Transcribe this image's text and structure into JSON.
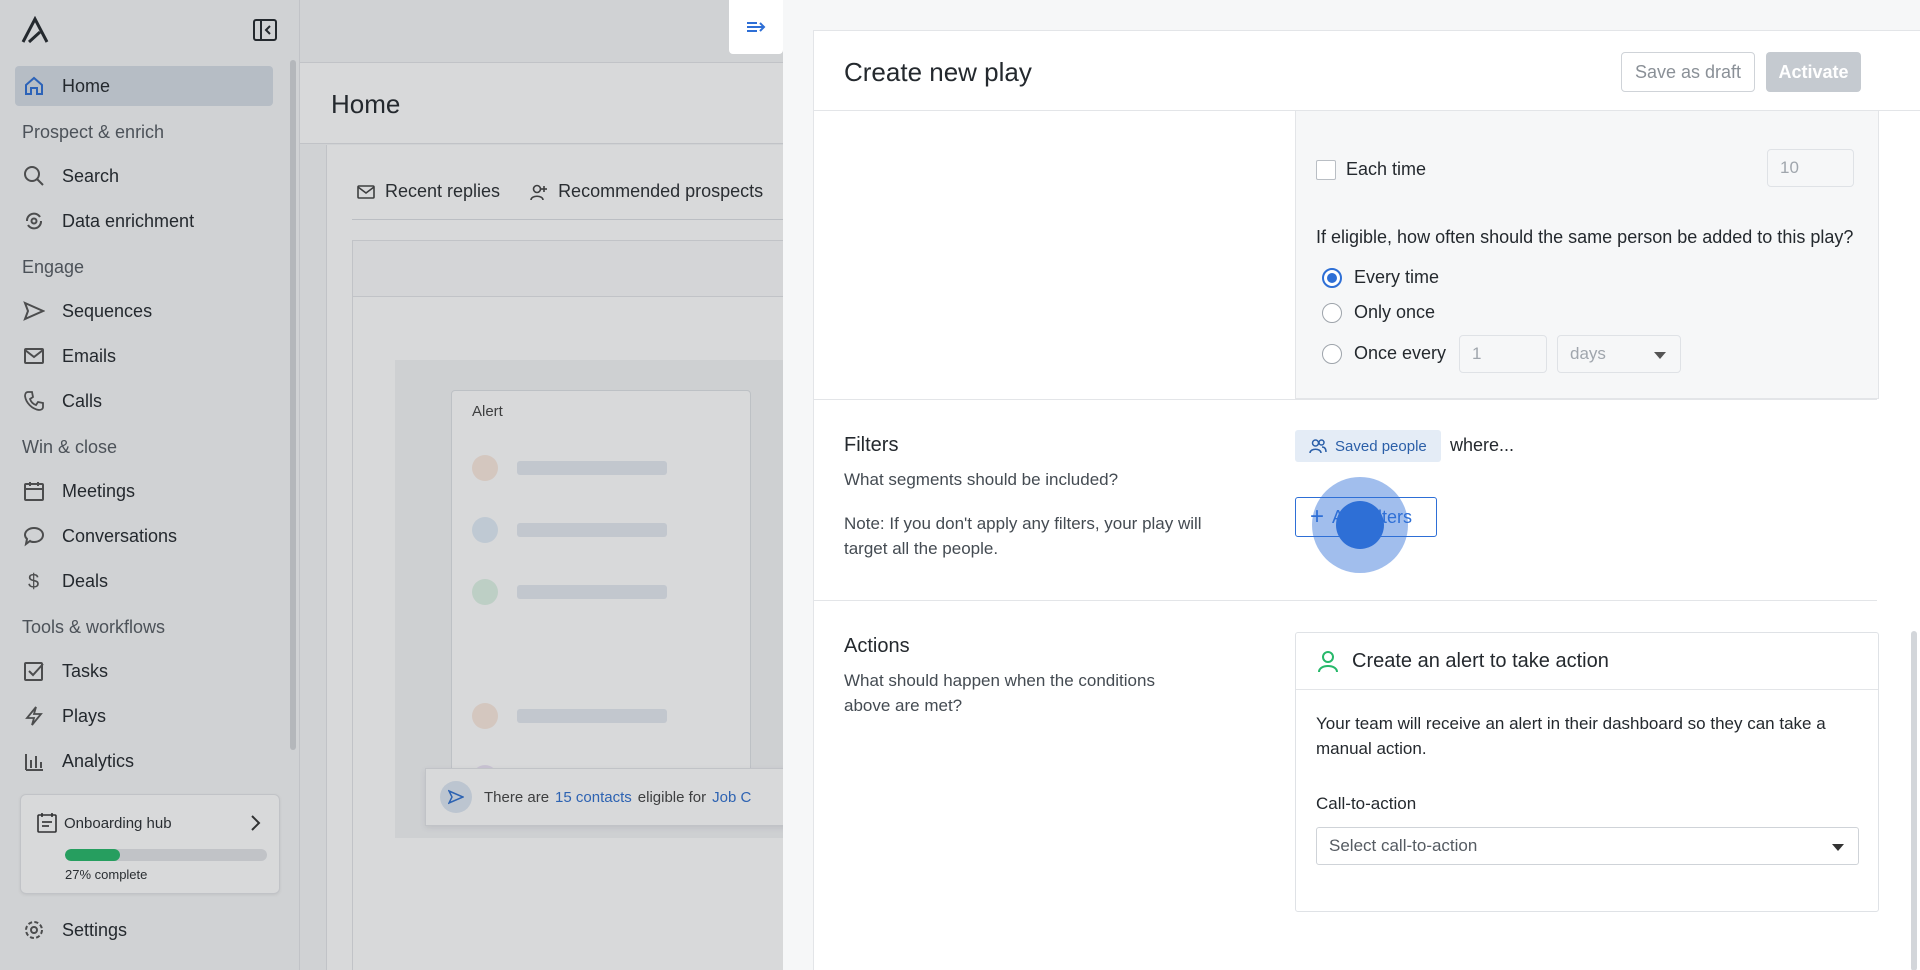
{
  "sidebar": {
    "nav_home": "Home",
    "section_prospect": "Prospect & enrich",
    "nav_search": "Search",
    "nav_data_enrichment": "Data enrichment",
    "section_engage": "Engage",
    "nav_sequences": "Sequences",
    "nav_emails": "Emails",
    "nav_calls": "Calls",
    "section_win": "Win & close",
    "nav_meetings": "Meetings",
    "nav_conversations": "Conversations",
    "nav_deals": "Deals",
    "section_tools": "Tools & workflows",
    "nav_tasks": "Tasks",
    "nav_plays": "Plays",
    "nav_analytics": "Analytics",
    "nav_settings": "Settings"
  },
  "onboarding": {
    "title": "Onboarding hub",
    "progress_text": "27% complete",
    "progress_fraction": 0.27
  },
  "main": {
    "title": "Home",
    "tab_recent_replies": "Recent replies",
    "tab_recommended": "Recommended prospects",
    "alert_title": "Alert",
    "eligible_prefix": "There are",
    "eligible_link": "15 contacts",
    "eligible_mid": "eligible for",
    "eligible_play": "Job C"
  },
  "drawer": {
    "title": "Create new play",
    "save_draft": "Save as draft",
    "activate": "Activate",
    "frequency": {
      "each_time_label": "Each time",
      "each_time_placeholder": "10",
      "question": "If eligible, how often should the same person be added to this play?",
      "opt_every_time": "Every time",
      "opt_only_once": "Only once",
      "opt_once_every": "Once every",
      "once_every_value": "1",
      "once_every_unit": "days"
    },
    "filters": {
      "title": "Filters",
      "desc": "What segments should be included?",
      "note": "Note: If you don't apply any filters, your play will target all the people.",
      "chip": "Saved people",
      "where": "where...",
      "add_button": "Add filters"
    },
    "actions": {
      "title": "Actions",
      "desc": "What should happen when the conditions above are met?",
      "card_title": "Create an alert to take action",
      "card_body": "Your team will receive an alert in their dashboard so they can take a manual action.",
      "cta_label": "Call-to-action",
      "cta_placeholder": "Select call-to-action"
    }
  },
  "colors": {
    "accent": "#2e6fd6",
    "progress": "#27b86a",
    "active_nav": "#d6dde6"
  }
}
